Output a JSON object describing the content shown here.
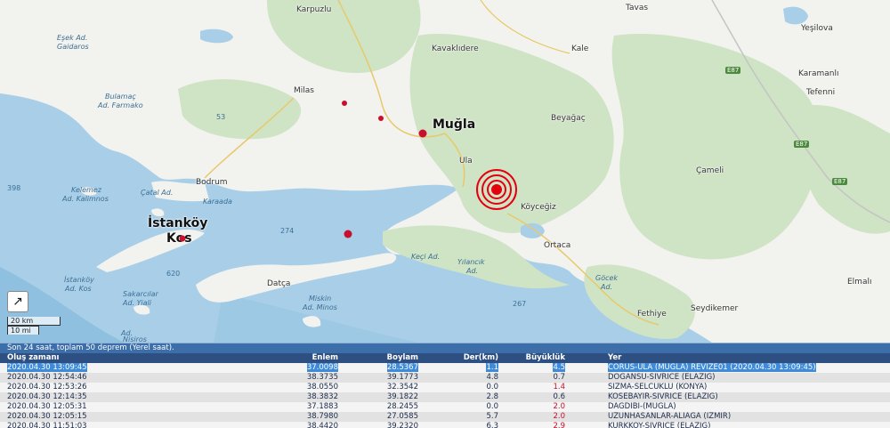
{
  "map": {
    "labels": {
      "karpuzlu": "Karpuzlu",
      "tavas": "Tavas",
      "yesilova": "Yeşilova",
      "kavaklidere": "Kavaklıdere",
      "kale": "Kale",
      "karamanli": "Karamanlı",
      "tefenni": "Tefenni",
      "esek_ad": "Eşek Ad.",
      "gaidaros": "Gaidaros",
      "milas": "Milas",
      "mugla": "Muğla",
      "beyagac": "Beyağaç",
      "bulamac_ad": "Bulamaç",
      "farmako": "Ad. Farmako",
      "ula": "Ula",
      "cameli": "Çameli",
      "bodrum": "Bodrum",
      "catal_ad": "Çatal Ad.",
      "kelemez": "Kelemez",
      "kalimnos": "Ad. Kalimnos",
      "karaada": "Karaada",
      "koycegiz": "Köyceğiz",
      "istankoy": "İstanköy",
      "kos": "Kos",
      "ortaca": "Ortaca",
      "istankoy_ad": "İstanköy",
      "ad_kos": "Ad. Kos",
      "keci_ad": "Keçi Ad.",
      "yilancik_ad": "Yılancık",
      "yilancik_ad2": "Ad.",
      "gocek_ad": "Göcek",
      "gocek_ad2": "Ad.",
      "sakarcilar": "Sakarcılar",
      "yiali": "Ad. Yiali",
      "datca": "Datça",
      "miskin": "Miskin",
      "ad_minos": "Ad. Minos",
      "fethiye": "Fethiye",
      "seydikemer": "Seydikemer",
      "elmali": "Elmalı",
      "nisiros": "Nisiros",
      "ilica_ad": "Ad."
    },
    "depths": {
      "d53": "53",
      "d398": "398",
      "d274": "274",
      "d620": "620",
      "d267": "267"
    },
    "roads": {
      "e87a": "E87",
      "e87b": "E87",
      "e87c": "E87"
    },
    "scale": {
      "km": "20 km",
      "mi": "10 mi"
    },
    "colors": {
      "sea": "#a9cfe8",
      "land": "#f2f2ee",
      "forest": "#cfe3c5",
      "epicenter": "#e4000f",
      "quake": "#c8102e"
    }
  },
  "list": {
    "title": "Son 24 saat, toplam 50 deprem (Yerel saat).",
    "headers": {
      "time": "Oluş zamanı",
      "lat": "Enlem",
      "lon": "Boylam",
      "depth": "Der(km)",
      "mag": "Büyüklük",
      "place": "Yer"
    },
    "rows": [
      {
        "time": "2020.04.30 13:09:45",
        "lat": "37.0098",
        "lon": "28.5367",
        "depth": "1.1",
        "mag": "4.5",
        "place": "CORUS-ULA (MUGLA) REVIZE01 (2020.04.30 13:09:45)",
        "mag_red": false
      },
      {
        "time": "2020.04.30 12:54:46",
        "lat": "38.3735",
        "lon": "39.1773",
        "depth": "4.8",
        "mag": "0.7",
        "place": "DOGANSU-SIVRICE (ELAZIG)",
        "mag_red": false
      },
      {
        "time": "2020.04.30 12:53:26",
        "lat": "38.0550",
        "lon": "32.3542",
        "depth": "0.0",
        "mag": "1.4",
        "place": "SIZMA-SELCUKLU (KONYA)",
        "mag_red": true
      },
      {
        "time": "2020.04.30 12:14:35",
        "lat": "38.3832",
        "lon": "39.1822",
        "depth": "2.8",
        "mag": "0.6",
        "place": "KOSEBAYIR-SIVRICE (ELAZIG)",
        "mag_red": false
      },
      {
        "time": "2020.04.30 12:05:31",
        "lat": "37.1883",
        "lon": "28.2455",
        "depth": "0.0",
        "mag": "2.0",
        "place": "DAGDIBI-(MUGLA)",
        "mag_red": true
      },
      {
        "time": "2020.04.30 12:05:15",
        "lat": "38.7980",
        "lon": "27.0585",
        "depth": "5.7",
        "mag": "2.0",
        "place": "UZUNHASANLAR-ALIAGA (IZMIR)",
        "mag_red": true
      },
      {
        "time": "2020.04.30 11:51:03",
        "lat": "38.4420",
        "lon": "39.2320",
        "depth": "6.3",
        "mag": "2.9",
        "place": "KURKKOY-SIVRICE (ELAZIG)",
        "mag_red": true
      }
    ]
  }
}
